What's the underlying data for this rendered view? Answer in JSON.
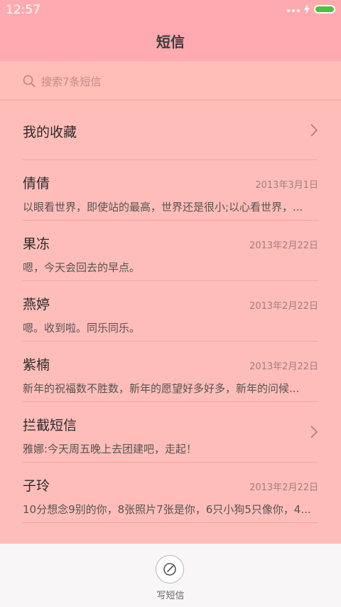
{
  "status": {
    "time": "12:57"
  },
  "header": {
    "title": "短信"
  },
  "search": {
    "placeholder": "搜索7条短信"
  },
  "favorites": {
    "label": "我的收藏"
  },
  "threads": [
    {
      "name": "倩倩",
      "date": "2013年3月1日",
      "snippet": "以眼看世界，即使站的最高，世界还是很小;以心看世界，..."
    },
    {
      "name": "果冻",
      "date": "2013年2月22日",
      "snippet": "嗯，今天会回去的早点。"
    },
    {
      "name": "燕婷",
      "date": "2013年2月22日",
      "snippet": "嗯。收到啦。同乐同乐。"
    },
    {
      "name": "紫楠",
      "date": "2013年2月22日",
      "snippet": "新年的祝福数不胜数，新年的愿望好多好多，新年的问候..."
    },
    {
      "name": "拦截短信",
      "date": "",
      "snippet": "雅娜:今天周五晚上去团建吧，走起！"
    },
    {
      "name": "子玲",
      "date": "2013年2月22日",
      "snippet": "10分想念9别的你，8张照片7张是你，6只小狗5只像你，4..."
    }
  ],
  "bottom": {
    "compose_label": "写短信"
  },
  "colors": {
    "header": "#ffaab0",
    "background": "#ffbdb9",
    "battery": "#4cc23a"
  }
}
